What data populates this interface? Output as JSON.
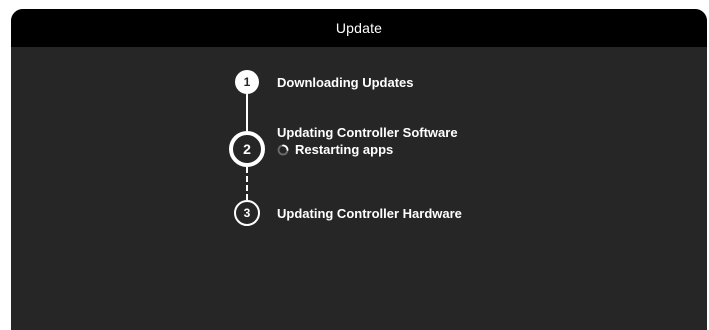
{
  "window": {
    "title": "Update"
  },
  "steps": [
    {
      "number": "1",
      "label": "Downloading Updates",
      "state": "complete"
    },
    {
      "number": "2",
      "label": "Updating Controller Software",
      "state": "active",
      "substatus": "Restarting apps"
    },
    {
      "number": "3",
      "label": "Updating Controller Hardware",
      "state": "pending"
    }
  ],
  "icons": {
    "spinner": "loading-spinner-icon"
  },
  "colors": {
    "background": "#262626",
    "titlebar": "#000000",
    "text": "#ffffff"
  }
}
